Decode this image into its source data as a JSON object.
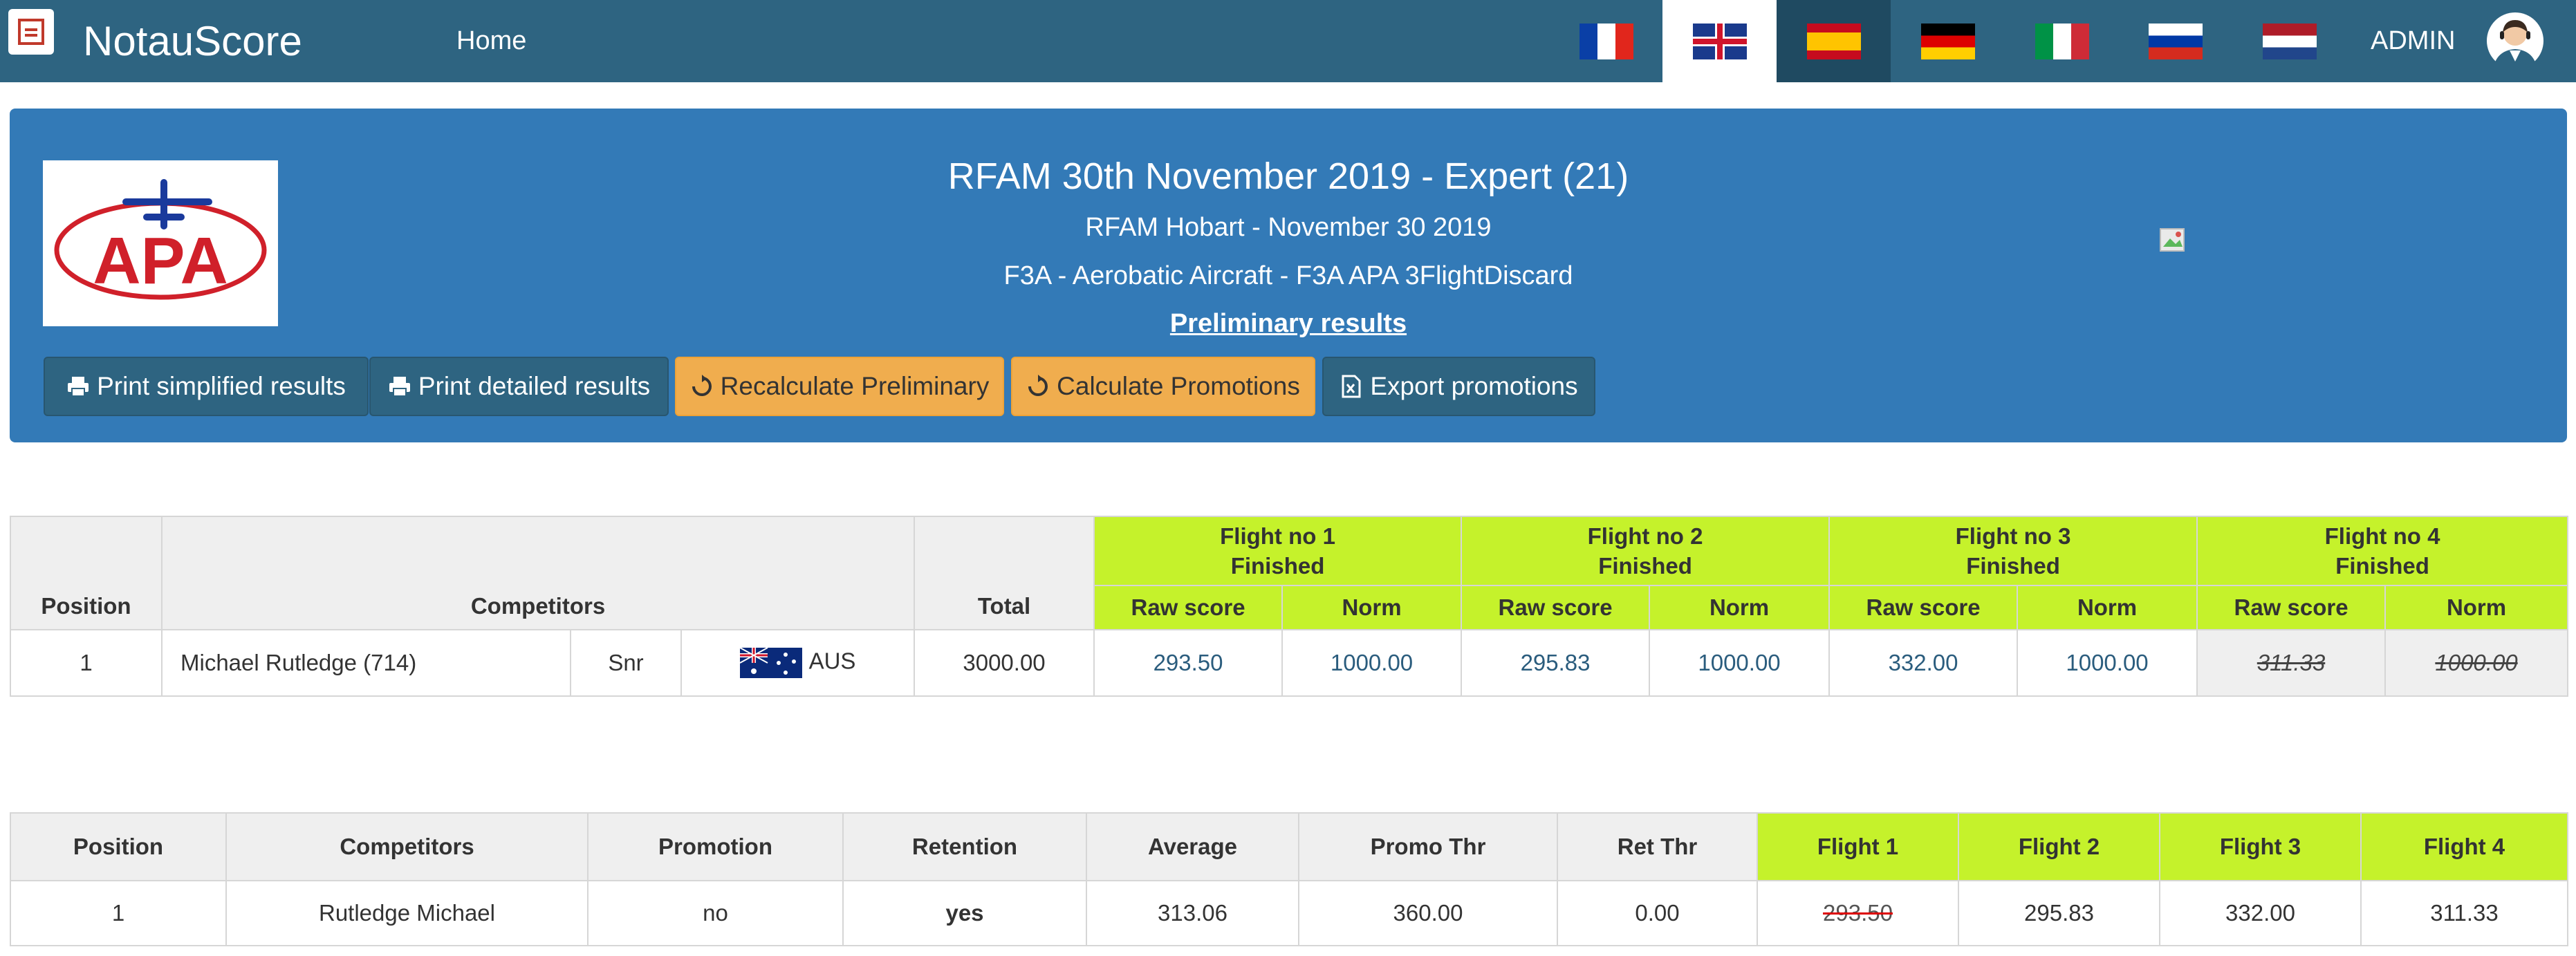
{
  "navbar": {
    "brand": "NotauScore",
    "home": "Home",
    "admin": "ADMIN",
    "flags": [
      "fr",
      "gb",
      "es",
      "de",
      "it",
      "ru",
      "nl"
    ]
  },
  "header": {
    "title": "RFAM 30th November 2019 - Expert (21)",
    "event": "RFAM Hobart - November 30 2019",
    "class": "F3A - Aerobatic Aircraft - F3A APA 3FlightDiscard",
    "status": "Preliminary results",
    "logo_text": "APA",
    "buttons": {
      "print_simplified": "Print simplified results",
      "print_detailed": "Print detailed results",
      "recalc": "Recalculate Preliminary",
      "calc_promotions": "Calculate Promotions",
      "export_promotions": "Export promotions"
    }
  },
  "results": {
    "headers": {
      "position": "Position",
      "competitors": "Competitors",
      "total": "Total",
      "raw": "Raw score",
      "norm": "Norm"
    },
    "flights": [
      {
        "name": "Flight no 1",
        "status": "Finished"
      },
      {
        "name": "Flight no 2",
        "status": "Finished"
      },
      {
        "name": "Flight no 3",
        "status": "Finished"
      },
      {
        "name": "Flight no 4",
        "status": "Finished"
      }
    ],
    "rows": [
      {
        "position": "1",
        "name": "Michael Rutledge (714)",
        "category": "Snr",
        "country": "AUS",
        "total": "3000.00",
        "scores": [
          {
            "raw": "293.50",
            "norm": "1000.00"
          },
          {
            "raw": "295.83",
            "norm": "1000.00"
          },
          {
            "raw": "332.00",
            "norm": "1000.00"
          },
          {
            "raw": "311.33",
            "norm": "1000.00"
          }
        ]
      }
    ]
  },
  "promotions": {
    "headers": [
      "Position",
      "Competitors",
      "Promotion",
      "Retention",
      "Average",
      "Promo Thr",
      "Ret Thr",
      "Flight 1",
      "Flight 2",
      "Flight 3",
      "Flight 4"
    ],
    "rows": [
      {
        "position": "1",
        "name": "Rutledge Michael",
        "promotion": "no",
        "retention": "yes",
        "average": "313.06",
        "promo_thr": "360.00",
        "ret_thr": "0.00",
        "flights": [
          "293.50",
          "295.83",
          "332.00",
          "311.33"
        ]
      }
    ]
  },
  "colors": {
    "navbar": "#2e6481",
    "panel": "#337ab7",
    "flight_header": "#c5f22b",
    "warning_button": "#f0ad4e"
  }
}
